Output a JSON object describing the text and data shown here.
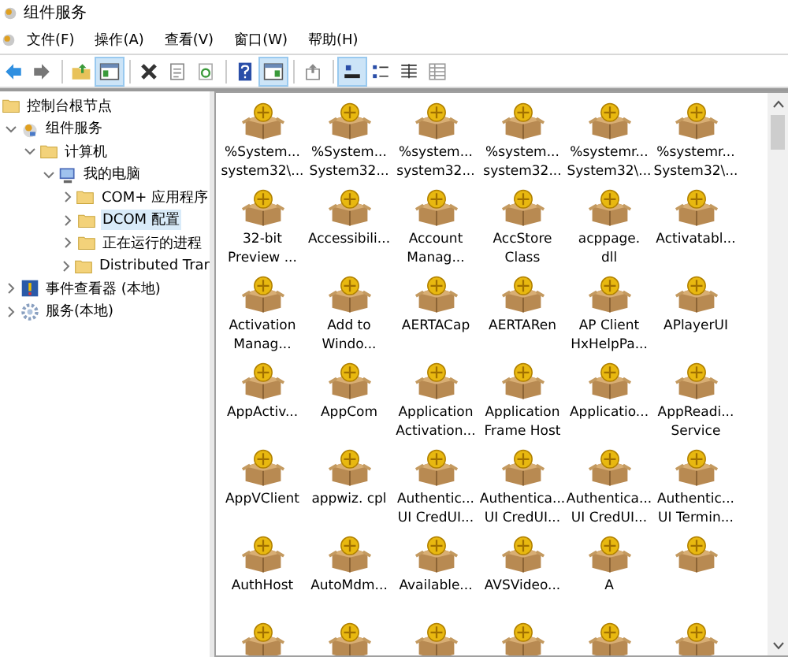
{
  "window": {
    "title": "组件服务"
  },
  "menu": [
    {
      "label": "文件(F)"
    },
    {
      "label": "操作(A)"
    },
    {
      "label": "查看(V)"
    },
    {
      "label": "窗口(W)"
    },
    {
      "label": "帮助(H)"
    }
  ],
  "toolbar": [
    {
      "kind": "back",
      "selected": false
    },
    {
      "kind": "forward",
      "selected": false
    },
    {
      "kind": "sep"
    },
    {
      "kind": "up-folder",
      "selected": false
    },
    {
      "kind": "console-tree",
      "selected": true
    },
    {
      "kind": "sep"
    },
    {
      "kind": "delete",
      "selected": false
    },
    {
      "kind": "properties",
      "selected": false
    },
    {
      "kind": "refresh",
      "selected": false
    },
    {
      "kind": "sep"
    },
    {
      "kind": "help",
      "selected": false
    },
    {
      "kind": "action-pane",
      "selected": true
    },
    {
      "kind": "sep"
    },
    {
      "kind": "export",
      "selected": false
    },
    {
      "kind": "sep"
    },
    {
      "kind": "large-icons",
      "selected": true
    },
    {
      "kind": "small-icons",
      "selected": false
    },
    {
      "kind": "list",
      "selected": false
    },
    {
      "kind": "details",
      "selected": false
    }
  ],
  "tree": [
    {
      "label": "控制台根节点",
      "kind": "folder",
      "selected": false,
      "children": [
        {
          "label": "组件服务",
          "kind": "component",
          "expanded": true,
          "selected": false,
          "children": [
            {
              "label": "计算机",
              "kind": "folder",
              "expanded": true,
              "selected": false,
              "children": [
                {
                  "label": "我的电脑",
                  "kind": "computer",
                  "expanded": true,
                  "selected": false,
                  "children": [
                    {
                      "label": "COM+ 应用程序",
                      "kind": "folder",
                      "expanded": false,
                      "selected": false
                    },
                    {
                      "label": "DCOM 配置",
                      "kind": "folder",
                      "expanded": false,
                      "selected": true
                    },
                    {
                      "label": "正在运行的进程",
                      "kind": "folder",
                      "expanded": false,
                      "selected": false
                    },
                    {
                      "label": "Distributed Trar",
                      "kind": "folder",
                      "expanded": false,
                      "selected": false
                    }
                  ]
                }
              ]
            }
          ]
        },
        {
          "label": "事件查看器 (本地)",
          "kind": "event-viewer",
          "expanded": false,
          "selected": false
        },
        {
          "label": "服务(本地)",
          "kind": "services",
          "expanded": false,
          "selected": false
        }
      ]
    }
  ],
  "items": [
    {
      "lines": [
        "%System...",
        "system32\\..."
      ]
    },
    {
      "lines": [
        "%System...",
        "System32..."
      ]
    },
    {
      "lines": [
        "%system...",
        "system32..."
      ]
    },
    {
      "lines": [
        "%system...",
        "system32..."
      ]
    },
    {
      "lines": [
        "%systemr...",
        "System32\\..."
      ]
    },
    {
      "lines": [
        "%systemr...",
        "System32\\..."
      ]
    },
    {
      "lines": [
        "32-bit",
        "Preview ..."
      ]
    },
    {
      "lines": [
        "Accessibili..."
      ]
    },
    {
      "lines": [
        "Account",
        "Manag..."
      ]
    },
    {
      "lines": [
        "AccStore",
        "Class"
      ]
    },
    {
      "lines": [
        "acppage.",
        "dll"
      ]
    },
    {
      "lines": [
        "Activatabl..."
      ]
    },
    {
      "lines": [
        "Activation",
        "Manag..."
      ]
    },
    {
      "lines": [
        "Add to",
        "Windo..."
      ]
    },
    {
      "lines": [
        "AERTACap"
      ]
    },
    {
      "lines": [
        "AERTARen"
      ]
    },
    {
      "lines": [
        "AP Client",
        "HxHelpPa..."
      ]
    },
    {
      "lines": [
        "APlayerUI"
      ]
    },
    {
      "lines": [
        "AppActiv..."
      ]
    },
    {
      "lines": [
        "AppCom"
      ]
    },
    {
      "lines": [
        "Application",
        "Activation..."
      ]
    },
    {
      "lines": [
        "Application",
        "Frame Host"
      ]
    },
    {
      "lines": [
        "Applicatio..."
      ]
    },
    {
      "lines": [
        "AppReadi...",
        "Service"
      ]
    },
    {
      "lines": [
        "AppVClient"
      ]
    },
    {
      "lines": [
        "appwiz. cpl"
      ]
    },
    {
      "lines": [
        "Authentic...",
        "UI CredUI..."
      ]
    },
    {
      "lines": [
        "Authentica...",
        "UI CredUI..."
      ]
    },
    {
      "lines": [
        "Authentica...",
        "UI CredUI..."
      ]
    },
    {
      "lines": [
        "Authentic...",
        "UI Termin..."
      ]
    },
    {
      "lines": [
        "AuthHost"
      ]
    },
    {
      "lines": [
        "AutoMdm..."
      ]
    },
    {
      "lines": [
        "Available..."
      ]
    },
    {
      "lines": [
        "AVSVideo..."
      ]
    },
    {
      "lines": [
        "A"
      ]
    },
    {
      "kind": "icon-only"
    },
    {
      "kind": "icon-only"
    },
    {
      "kind": "icon-only"
    },
    {
      "kind": "icon-only"
    },
    {
      "kind": "icon-only"
    },
    {
      "kind": "icon-only"
    },
    {
      "kind": "icon-only"
    }
  ]
}
